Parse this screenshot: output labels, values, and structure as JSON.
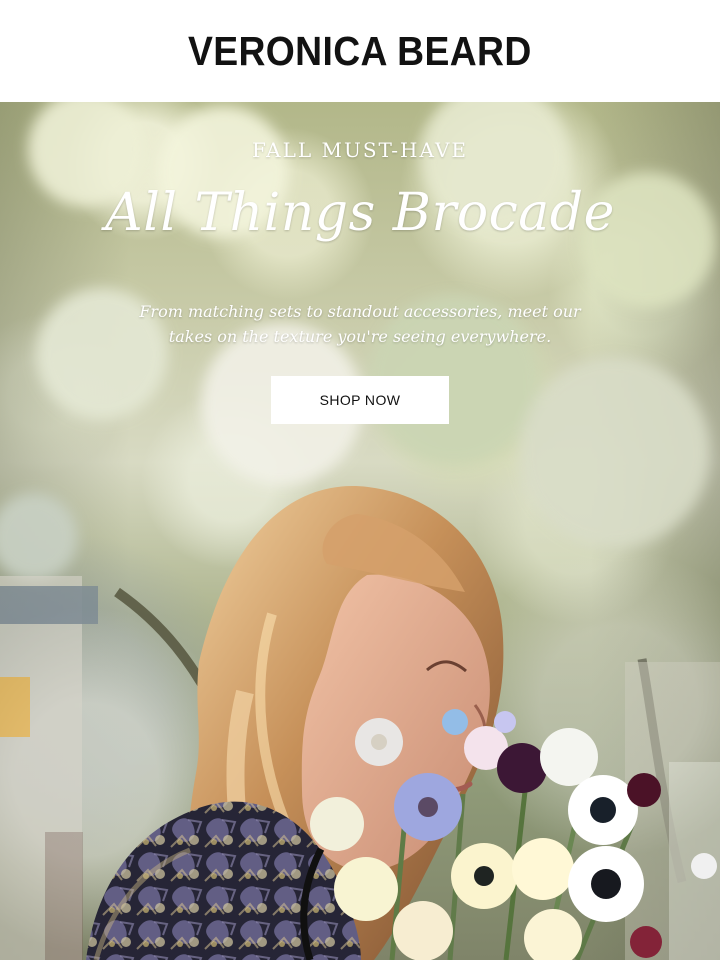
{
  "brand": {
    "name": "VERONICA BEARD"
  },
  "hero": {
    "kicker": "FALL MUST-HAVE",
    "title": "All Things Brocade",
    "description": "From matching sets to standout accessories, meet our takes on the texture you're seeing everywhere.",
    "cta_label": "SHOP NOW"
  },
  "colors": {
    "header_background": "#FFFFFF",
    "logo": "#121212",
    "hero_text": "#FFFFFF",
    "button_background": "#FFFFFF",
    "button_text": "#111111"
  }
}
